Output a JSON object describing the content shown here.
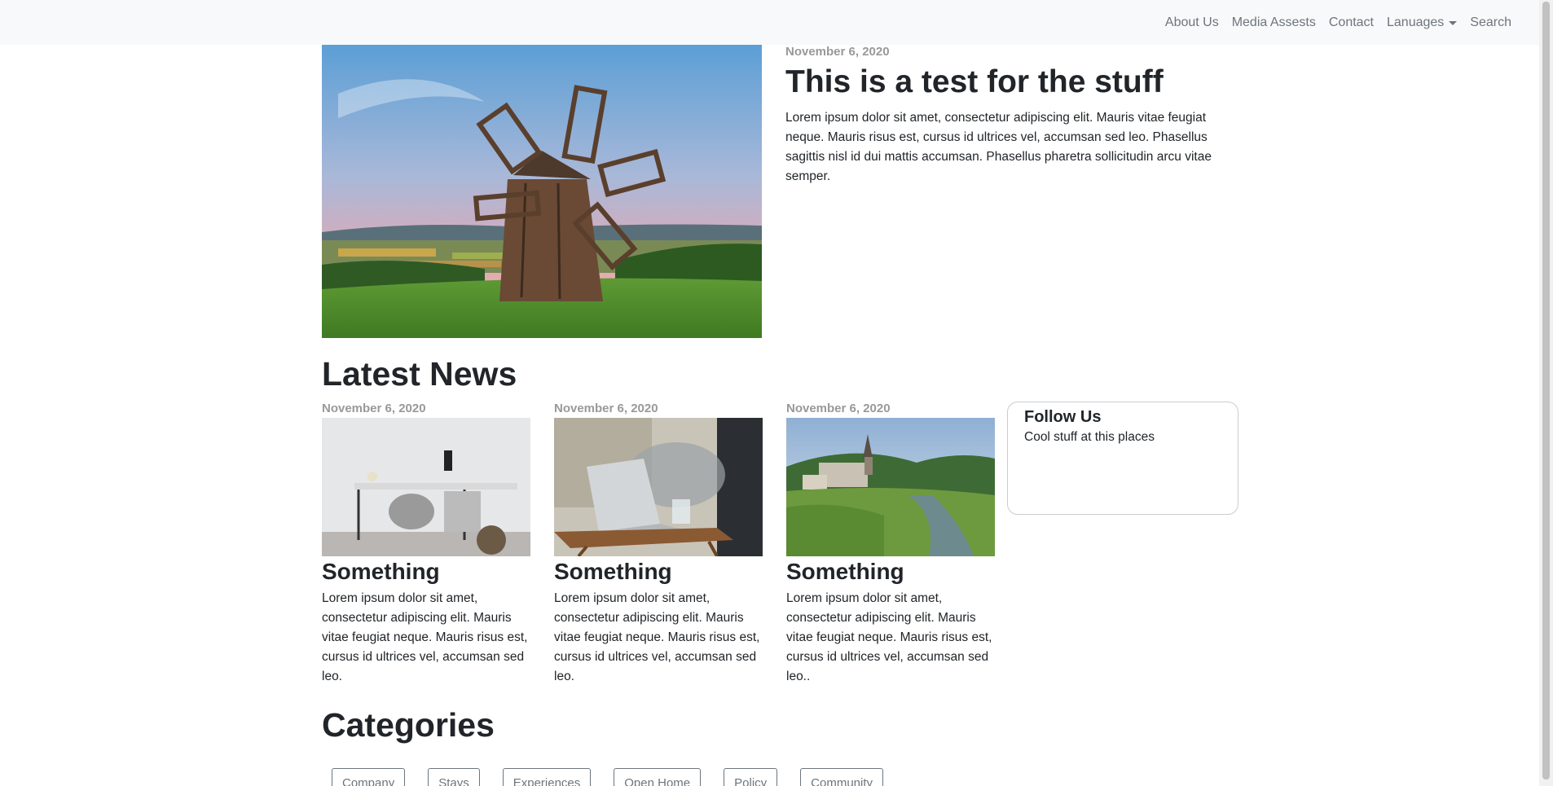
{
  "nav": {
    "items": [
      {
        "label": "About Us"
      },
      {
        "label": "Media Assests"
      },
      {
        "label": "Contact"
      },
      {
        "label": "Lanuages"
      },
      {
        "label": "Search"
      }
    ]
  },
  "hero": {
    "date": "November 6, 2020",
    "title": "This is a test for the stuff",
    "body": "Lorem ipsum dolor sit amet, consectetur adipiscing elit. Mauris vitae feugiat neque. Mauris risus est, cursus id ultrices vel, accumsan sed leo. Phasellus sagittis nisl id dui mattis accumsan. Phasellus pharetra sollicitudin arcu vitae semper."
  },
  "latest_news": {
    "heading": "Latest News",
    "cards": [
      {
        "date": "November 6, 2020",
        "title": "Something",
        "body": "Lorem ipsum dolor sit amet, consectetur adipiscing elit. Mauris vitae feugiat neque. Mauris risus est, cursus id ultrices vel, accumsan sed leo."
      },
      {
        "date": "November 6, 2020",
        "title": "Something",
        "body": "Lorem ipsum dolor sit amet, consectetur adipiscing elit. Mauris vitae feugiat neque. Mauris risus est, cursus id ultrices vel, accumsan sed leo."
      },
      {
        "date": "November 6, 2020",
        "title": "Something",
        "body": "Lorem ipsum dolor sit amet, consectetur adipiscing elit. Mauris vitae feugiat neque. Mauris risus est, cursus id ultrices vel, accumsan sed leo.."
      }
    ]
  },
  "follow": {
    "title": "Follow Us",
    "text": "Cool stuff at this places"
  },
  "categories": {
    "heading": "Categories",
    "items": [
      "Company",
      "Stays",
      "Experiences",
      "Open Home",
      "Policy",
      "Community"
    ]
  }
}
